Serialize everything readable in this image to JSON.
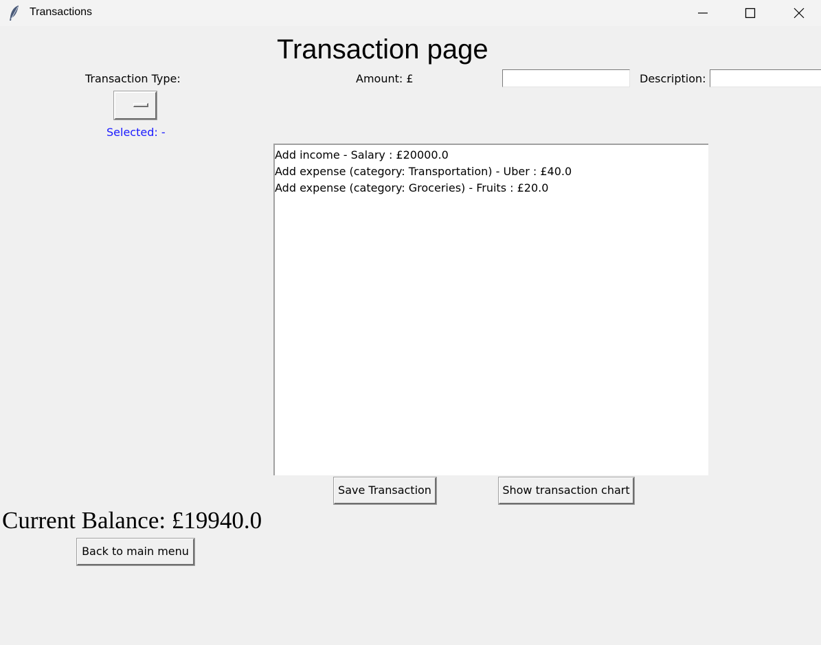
{
  "window": {
    "title": "Transactions",
    "app_icon": "feather-icon",
    "controls": [
      "minimize-icon",
      "maximize-icon",
      "close-icon"
    ]
  },
  "page": {
    "title": "Transaction page"
  },
  "form": {
    "type_label": "Transaction Type:",
    "type_selected_value": "",
    "selected_text": "Selected: -",
    "amount_label": "Amount: £",
    "amount_value": "",
    "description_label": "Description:",
    "description_value": ""
  },
  "transactions": [
    "Add income - Salary : £20000.0",
    "Add expense (category: Transportation) - Uber : £40.0",
    "Add expense (category: Groceries) - Fruits : £20.0"
  ],
  "buttons": {
    "save": "Save Transaction",
    "chart": "Show transaction chart",
    "back": "Back to main menu"
  },
  "balance": {
    "text": "Current Balance: £19940.0"
  },
  "colors": {
    "background": "#f0f0f0",
    "selected_text": "#1a1aff",
    "listbox_bg": "#ffffff"
  }
}
